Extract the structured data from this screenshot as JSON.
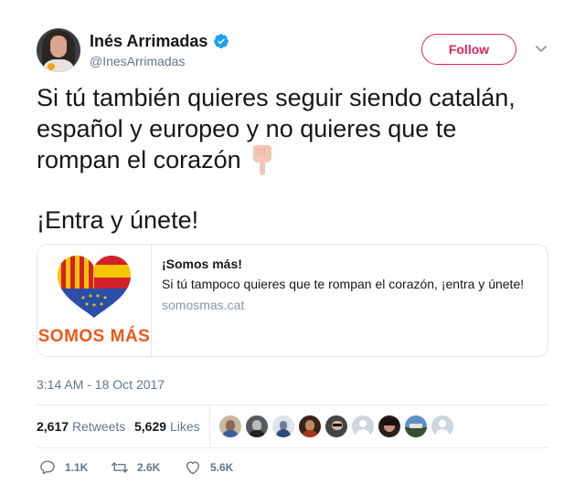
{
  "author": {
    "name": "Inés Arrimadas",
    "handle": "@InesArrimadas",
    "verified": true
  },
  "follow_label": "Follow",
  "tweet": {
    "lines": [
      "Si tú también quieres seguir siendo catalán,",
      "español y europeo y no quieres que te",
      "rompan el corazón"
    ],
    "emoji": "backhand-index-pointing-down",
    "cta": "¡Entra y únete!"
  },
  "card": {
    "logo_text": "SOMOS MÁS",
    "title": "¡Somos más!",
    "description": "Si tú tampoco quieres que te rompan el corazón, ¡entra y únete!",
    "domain": "somosmas.cat"
  },
  "timestamp": "3:14 AM - 18 Oct 2017",
  "stats": {
    "retweets_count": "2,617",
    "retweets_label": "Retweets",
    "likes_count": "5,629",
    "likes_label": "Likes"
  },
  "actions": {
    "replies": "1.1K",
    "retweets": "2.6K",
    "likes": "5.6K"
  },
  "colors": {
    "accent": "#e0245e",
    "verified": "#1da1f2",
    "muted": "#657786",
    "card_logo": "#e85a1b"
  }
}
